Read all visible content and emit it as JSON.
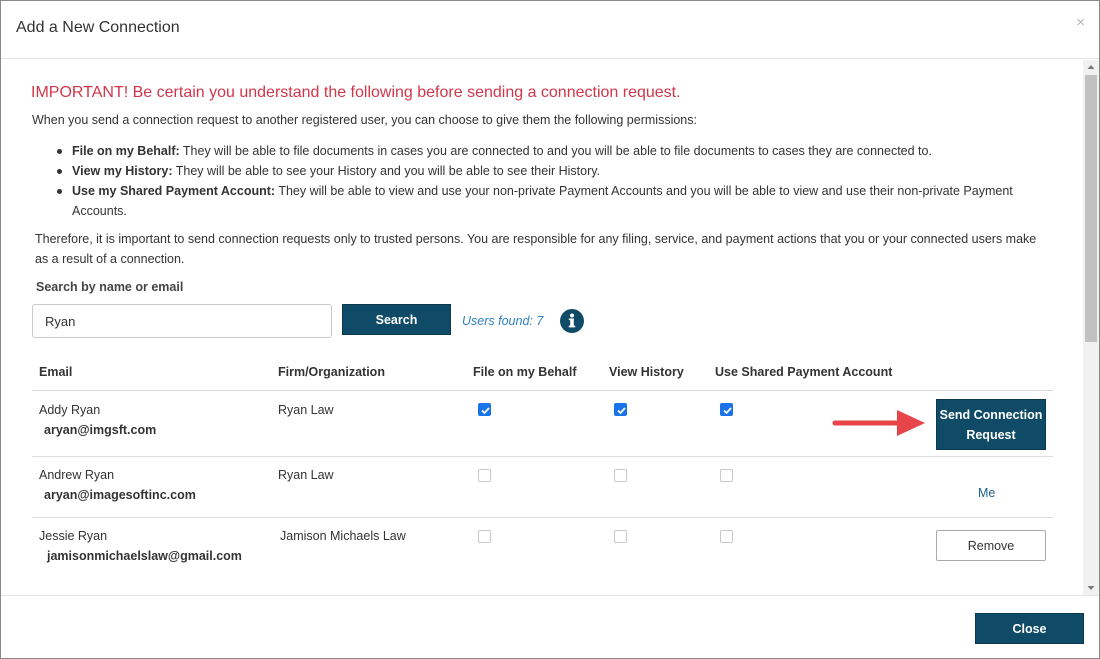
{
  "dialog": {
    "title": "Add a New Connection",
    "close_glyph": "×"
  },
  "notice": {
    "title": "IMPORTANT! Be certain you understand the following before sending a connection request.",
    "intro": "When you send a connection request to another registered user, you can choose to give them the following permissions:",
    "permissions": [
      {
        "term": "File on my Behalf:",
        "text": "They will be able to file documents in cases you are connected to and you will be able to file documents to cases they are connected to."
      },
      {
        "term": "View my History:",
        "text": "They will be able to see your History and you will be able to see their History."
      },
      {
        "term": "Use my Shared Payment Account:",
        "text": "They will be able to view and use your non-private Payment Accounts and you will be able to view and use their non-private Payment Accounts."
      }
    ],
    "therefore": "Therefore, it is important to send connection requests only to trusted persons. You are responsible for any filing, service, and payment actions that you or your connected users make as a result of a connection."
  },
  "search": {
    "label": "Search by name or email",
    "value": "Ryan",
    "button_label": "Search",
    "users_found": "Users found: 7",
    "info_icon": "info-circle-icon"
  },
  "table": {
    "headers": {
      "email": "Email",
      "firm": "Firm/Organization",
      "file_on_behalf": "File on my Behalf",
      "view_history": "View History",
      "use_shared_payment": "Use Shared Payment Account"
    },
    "rows": [
      {
        "name": "Addy Ryan",
        "email": "aryan@imgsft.com",
        "firm": "Ryan Law",
        "file_on_behalf": true,
        "view_history": true,
        "use_shared_payment": true,
        "enabled": true,
        "action": "Send Connection Request"
      },
      {
        "name": "Andrew Ryan",
        "email": "aryan@imagesoftinc.com",
        "firm": "Ryan Law",
        "file_on_behalf": false,
        "view_history": false,
        "use_shared_payment": false,
        "enabled": false,
        "action": "Me"
      },
      {
        "name": "Jessie Ryan",
        "email": "jamisonmichaelslaw@gmail.com",
        "firm": "Jamison Michaels Law",
        "file_on_behalf": false,
        "view_history": false,
        "use_shared_payment": false,
        "enabled": false,
        "action": "Remove"
      }
    ]
  },
  "footer": {
    "close_label": "Close"
  },
  "colors": {
    "primary_button": "#0f4b66",
    "important_text": "#d0364a",
    "link_text": "#2d7fc0",
    "checkbox_checked": "#1a73e8",
    "annotation_arrow": "#e8454a"
  }
}
